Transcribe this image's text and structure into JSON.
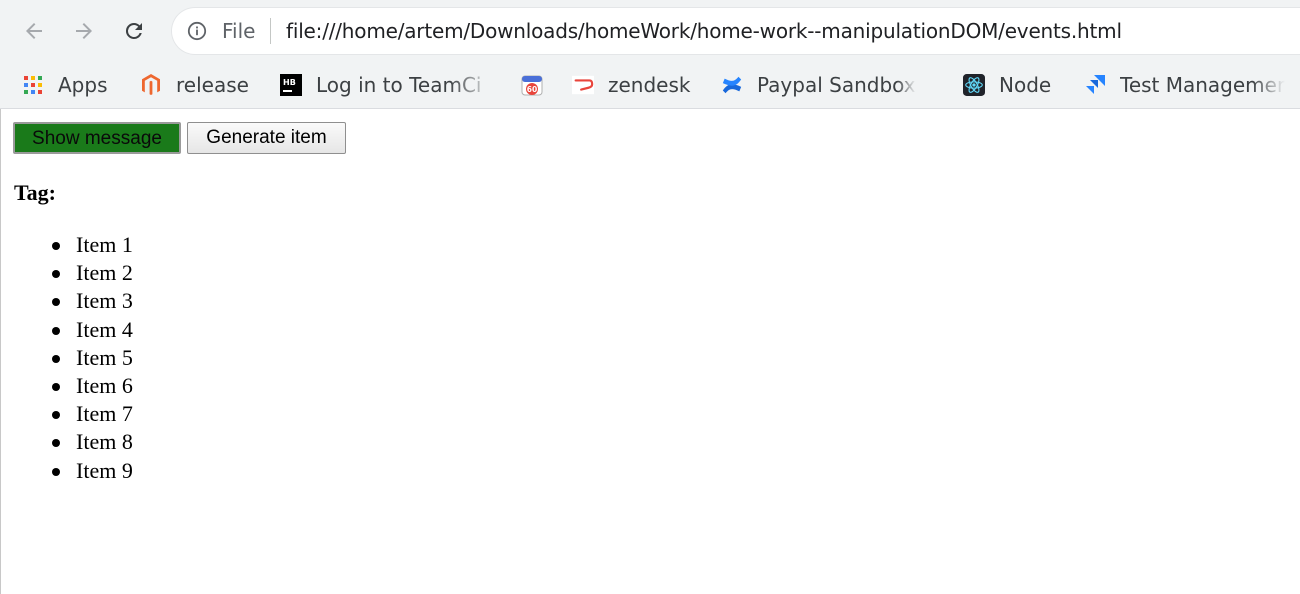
{
  "browser": {
    "address_bar": {
      "scheme_label": "File",
      "url": "file:///home/artem/Downloads/homeWork/home-work--manipulationDOM/events.html"
    },
    "bookmarks": [
      {
        "label": "Apps",
        "icon": "apps-grid-icon"
      },
      {
        "label": "release",
        "icon": "magento-icon"
      },
      {
        "label": "Log in to TeamCi",
        "icon": "teamcity-icon"
      },
      {
        "label": "",
        "icon": "calendar-60-icon"
      },
      {
        "label": "zendesk",
        "icon": "zendesk-icon"
      },
      {
        "label": "Paypal Sandbox",
        "icon": "confluence-icon"
      },
      {
        "label": "Node",
        "icon": "react-icon"
      },
      {
        "label": "Test Managemer",
        "icon": "jira-icon"
      }
    ],
    "calendar_badge_text": "60",
    "teamcity_badge_text": "HB"
  },
  "page": {
    "buttons": {
      "show_message": "Show message",
      "generate_item": "Generate item"
    },
    "tag_heading": "Tag:",
    "items": [
      "Item 1",
      "Item 2",
      "Item 3",
      "Item 4",
      "Item 5",
      "Item 6",
      "Item 7",
      "Item 8",
      "Item 9"
    ],
    "colors": {
      "show_message_bg": "#1a7a1a"
    }
  }
}
